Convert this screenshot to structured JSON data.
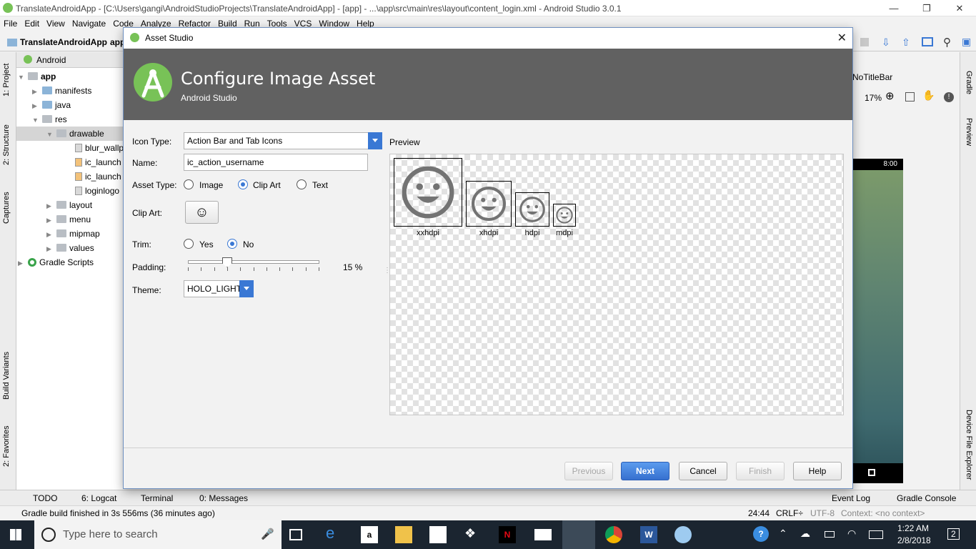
{
  "window": {
    "title": "TranslateAndroidApp - [C:\\Users\\gangi\\AndroidStudioProjects\\TranslateAndroidApp] - [app] - ...\\app\\src\\main\\res\\layout\\content_login.xml - Android Studio 3.0.1"
  },
  "menu": [
    "File",
    "Edit",
    "View",
    "Navigate",
    "Code",
    "Analyze",
    "Refactor",
    "Build",
    "Run",
    "Tools",
    "VCS",
    "Window",
    "Help"
  ],
  "navbar": {
    "project": "TranslateAndroidApp",
    "partial": "app"
  },
  "left_tool_tabs": [
    "1: Project",
    "2: Structure",
    "Captures",
    "Build Variants",
    "2: Favorites"
  ],
  "project_panel": {
    "view": "Android",
    "items": [
      {
        "label": "app"
      },
      {
        "label": "manifests"
      },
      {
        "label": "java"
      },
      {
        "label": "res"
      },
      {
        "label": "drawable"
      },
      {
        "label": "blur_wallp"
      },
      {
        "label": "ic_launch"
      },
      {
        "label": "ic_launch"
      },
      {
        "label": "loginlogo"
      },
      {
        "label": "layout"
      },
      {
        "label": "menu"
      },
      {
        "label": "mipmap"
      },
      {
        "label": "values"
      },
      {
        "label": "Gradle Scripts"
      }
    ]
  },
  "editor": {
    "theme_partial": "NoTitleBar",
    "zoom": "17%",
    "phone_time": "8:00"
  },
  "right_tool_tabs": [
    "Gradle",
    "Preview",
    "Device File Explorer"
  ],
  "dialog": {
    "title": "Asset Studio",
    "header": "Configure Image Asset",
    "subheader": "Android Studio",
    "icon_type_label": "Icon Type:",
    "icon_type_value": "Action Bar and Tab Icons",
    "name_label": "Name:",
    "name_value": "ic_action_username",
    "asset_type_label": "Asset Type:",
    "asset_type_options": [
      "Image",
      "Clip Art",
      "Text"
    ],
    "asset_type_selected": "Clip Art",
    "clip_art_label": "Clip Art:",
    "clip_art_icon": "☺",
    "trim_label": "Trim:",
    "trim_options": [
      "Yes",
      "No"
    ],
    "trim_selected": "No",
    "padding_label": "Padding:",
    "padding_value": "15 %",
    "padding_level": 0.15,
    "theme_label": "Theme:",
    "theme_value": "HOLO_LIGHT",
    "preview_label": "Preview",
    "densities": [
      "xxhdpi",
      "xhdpi",
      "hdpi",
      "mdpi"
    ],
    "buttons": {
      "previous": "Previous",
      "next": "Next",
      "cancel": "Cancel",
      "finish": "Finish",
      "help": "Help"
    }
  },
  "bottom_tabs": [
    "TODO",
    "6: Logcat",
    "Terminal",
    "0: Messages",
    "Event Log",
    "Gradle Console"
  ],
  "status": {
    "message": "Gradle build finished in 3s 556ms (36 minutes ago)",
    "position": "24:44",
    "line_sep": "CRLF÷",
    "encoding": "UTF-8",
    "context": "Context: <no context>"
  },
  "taskbar": {
    "search_placeholder": "Type here to search",
    "time": "1:22 AM",
    "date": "2/8/2018",
    "notifications": "2"
  },
  "colors": {
    "accent": "#3a78d4",
    "header": "#616161",
    "android_green": "#78c257"
  }
}
